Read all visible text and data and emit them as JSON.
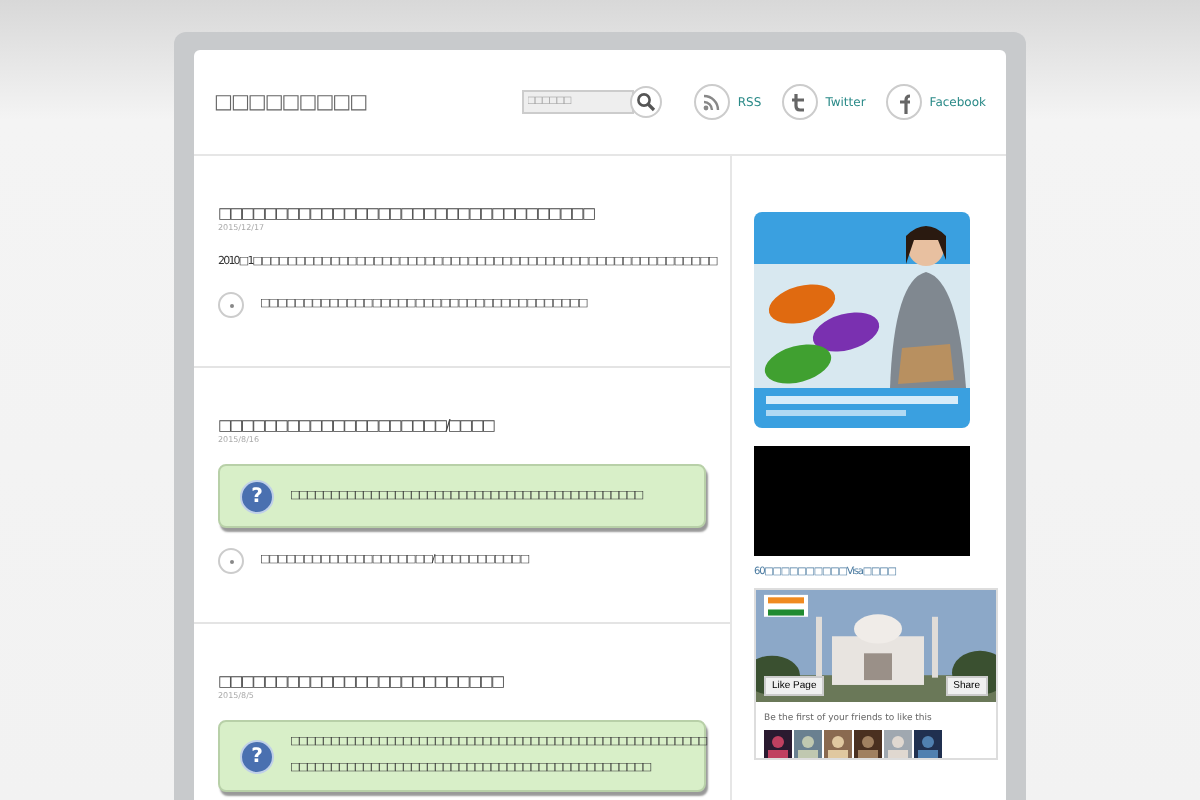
{
  "site_title": "□□□□□□□□□",
  "search": {
    "placeholder": "□□□□□□"
  },
  "social_links": [
    {
      "kind": "rss",
      "label": "RSS"
    },
    {
      "kind": "twitter",
      "label": "Twitter"
    },
    {
      "kind": "facebook",
      "label": "Facebook"
    }
  ],
  "posts": [
    {
      "title": "□□□□□□□□□□□□□□□□□□□□□□□□□□□□□□□□□",
      "date": "2015/12/17",
      "blocks": [
        {
          "kind": "paragraph",
          "text": "2010□1□□□□□□□□□□□□□□□□□□□□□□□□□□□□□□□□□□□□□□□□□□□□□□□□□□□□□□"
        },
        {
          "kind": "bullet",
          "text": "□□□□□□□□□□□□□□□□□□□□□□□□□□□□□□□□□□□□□□"
        }
      ]
    },
    {
      "title": "□□□□□□□□□□□□□□□□□□□□/□□□□",
      "date": "2015/8/16",
      "blocks": [
        {
          "kind": "question",
          "icon": "?",
          "lines": [
            "□□□□□□□□□□□□□□□□□□□□□□□□□□□□□□□□□□□□□□□□□□□□"
          ]
        },
        {
          "kind": "bullet",
          "text": "□□□□□□□□□□□□□□□□□□□□/□□□□□□□□□□□"
        }
      ]
    },
    {
      "title": "□□□□□□□□□□□□□□□□□□□□□□□□□",
      "date": "2015/8/5",
      "blocks": [
        {
          "kind": "question",
          "icon": "?",
          "lines": [
            "□□□□□□□□□□□□□□□□□□□□□□□□□□□□□□□□□□□□□□□□□□□□□□□□□□□□",
            "□□□□□□□□□□□□□□□□□□□□□□□□□□□□□□□□□□□□□□□□□□□□□"
          ]
        }
      ]
    }
  ],
  "sidebar": {
    "video": {
      "caption": "60□□□□□□□□□□Visa□□□□"
    },
    "facebook_widget": {
      "like_button": "Like Page",
      "share_button": "Share",
      "friends_text": "Be the first of your friends to like this"
    }
  }
}
